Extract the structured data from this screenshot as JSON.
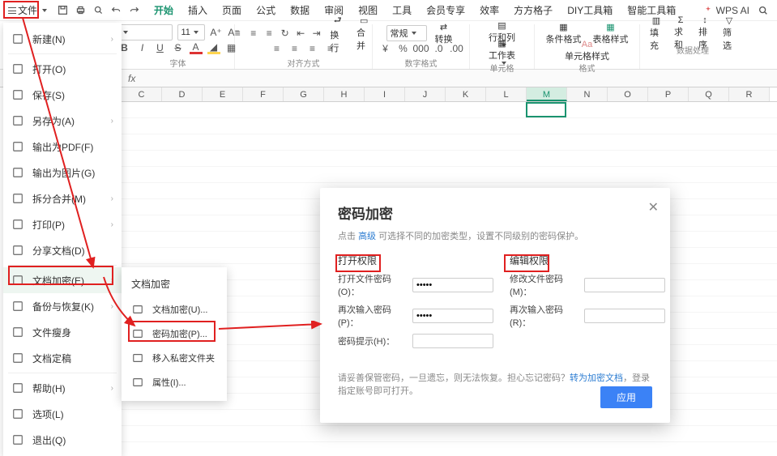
{
  "topbar": {
    "file_label": "文件",
    "tabs": [
      "开始",
      "插入",
      "页面",
      "公式",
      "数据",
      "审阅",
      "视图",
      "工具",
      "会员专享",
      "效率",
      "方方格子",
      "DIY工具箱",
      "智能工具箱"
    ],
    "active_tab_index": 0,
    "wps_ai": "WPS AI"
  },
  "ribbon": {
    "font_size_value": "11",
    "group1": "字体",
    "group2": "对齐方式",
    "auto_wrap": "换行",
    "merge": "合并",
    "general_dd": "常规",
    "convert": "转换",
    "group3": "数字格式",
    "rowcol": "行和列",
    "worksheet": "工作表",
    "group4": "单元格",
    "cond_fmt": "条件格式",
    "table_style": "表格样式",
    "cell_style": "单元格样式",
    "group5": "格式",
    "fill": "填充",
    "sum": "求和",
    "sort": "排序",
    "filter": "筛选",
    "group6": "数据处理"
  },
  "columns": [
    "C",
    "D",
    "E",
    "F",
    "G",
    "H",
    "I",
    "J",
    "K",
    "L",
    "M",
    "N",
    "O",
    "P",
    "Q",
    "R"
  ],
  "active_col": "M",
  "file_menu": {
    "items": [
      {
        "label": "新建(N)",
        "icon": "file-plus",
        "arrow": true
      },
      {
        "label": "打开(O)",
        "icon": "folder-open"
      },
      {
        "label": "保存(S)",
        "icon": "save"
      },
      {
        "label": "另存为(A)",
        "icon": "save-as",
        "arrow": true
      },
      {
        "label": "输出为PDF(F)",
        "icon": "pdf"
      },
      {
        "label": "输出为图片(G)",
        "icon": "image"
      },
      {
        "label": "拆分合并(M)",
        "icon": "split",
        "arrow": true
      },
      {
        "label": "打印(P)",
        "icon": "print",
        "arrow": true
      },
      {
        "label": "分享文档(D)",
        "icon": "share"
      },
      {
        "label": "文档加密(E)",
        "icon": "lock",
        "arrow": true,
        "active": true
      },
      {
        "label": "备份与恢复(K)",
        "icon": "backup",
        "arrow": true
      },
      {
        "label": "文件瘦身",
        "icon": "compress"
      },
      {
        "label": "文档定稿",
        "icon": "stamp"
      },
      {
        "label": "帮助(H)",
        "icon": "help",
        "arrow": true
      },
      {
        "label": "选项(L)",
        "icon": "gear"
      },
      {
        "label": "退出(Q)",
        "icon": "exit"
      }
    ]
  },
  "sub_menu": {
    "title": "文档加密",
    "items": [
      {
        "label": "文档加密(U)...",
        "icon": "lock"
      },
      {
        "label": "密码加密(P)...",
        "icon": "key",
        "hilite": true
      },
      {
        "label": "移入私密文件夹",
        "icon": "folder-lock"
      },
      {
        "label": "属性(I)...",
        "icon": "info"
      }
    ]
  },
  "dialog": {
    "title": "密码加密",
    "desc_before": "点击 ",
    "desc_link": "高级",
    "desc_after": " 可选择不同的加密类型，设置不同级别的密码保护。",
    "open_perm": "打开权限",
    "edit_perm": "编辑权限",
    "open_pw_label": "打开文件密码(O)：",
    "open_pw_value": "•••••",
    "open_again_label": "再次输入密码(P)：",
    "open_again_value": "•••••",
    "hint_label": "密码提示(H)：",
    "hint_value": "",
    "edit_pw_label": "修改文件密码(M)：",
    "edit_pw_value": "",
    "edit_again_label": "再次输入密码(R)：",
    "edit_again_value": "",
    "footnote_before": "请妥善保管密码，一旦遗忘，则无法恢复。担心忘记密码？",
    "footnote_link": "转为加密文档",
    "footnote_after": "，登录指定账号即可打开。",
    "apply": "应用"
  }
}
